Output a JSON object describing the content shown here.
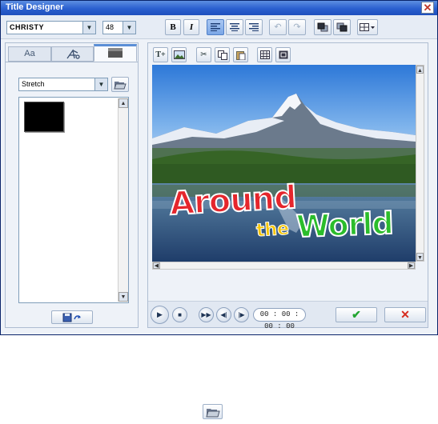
{
  "window": {
    "title": "Title Designer",
    "close_glyph": "✕"
  },
  "toolbar": {
    "font_name": "CHRISTY",
    "font_size": "48",
    "bold_label": "B",
    "italic_label": "I",
    "align_left_icon": "align-left-icon",
    "align_center_icon": "align-center-icon",
    "align_right_icon": "align-right-icon",
    "undo_icon": "undo-icon",
    "redo_icon": "redo-icon",
    "bring_front_icon": "bring-to-front-icon",
    "send_back_icon": "send-to-back-icon",
    "layout_icon": "layout-icon"
  },
  "left_panel": {
    "tabs": [
      {
        "label": "Aa",
        "icon": "text-style-icon",
        "selected": false
      },
      {
        "label": "",
        "icon": "effects-icon",
        "selected": false
      },
      {
        "label": "",
        "icon": "background-icon",
        "selected": true
      }
    ],
    "fit_mode": "Stretch",
    "open_icon": "folder-open-icon",
    "save_icon": "save-icon"
  },
  "canvas": {
    "title_line1": "Around",
    "title_line2a": "the",
    "title_line2b": "World"
  },
  "edit_tools": [
    "add-text-icon",
    "insert-image-icon",
    "cut-icon",
    "copy-icon",
    "paste-icon",
    "grid-icon",
    "safe-area-icon"
  ],
  "playback": {
    "timecode": "00 : 00 : 00 : 00",
    "play_icon": "play-icon",
    "stop_icon": "stop-icon",
    "ffwd_icon": "fast-forward-icon",
    "prev_frame_icon": "previous-frame-icon",
    "next_frame_icon": "next-frame-icon"
  },
  "actions": {
    "ok_glyph": "✔",
    "cancel_glyph": "✕"
  },
  "colors": {
    "accent": "#2a5fcf",
    "ok": "#22a531",
    "cancel": "#d62b1f",
    "title_red": "#e5262c",
    "title_yellow": "#f5c400",
    "title_green": "#2bbd2b"
  }
}
